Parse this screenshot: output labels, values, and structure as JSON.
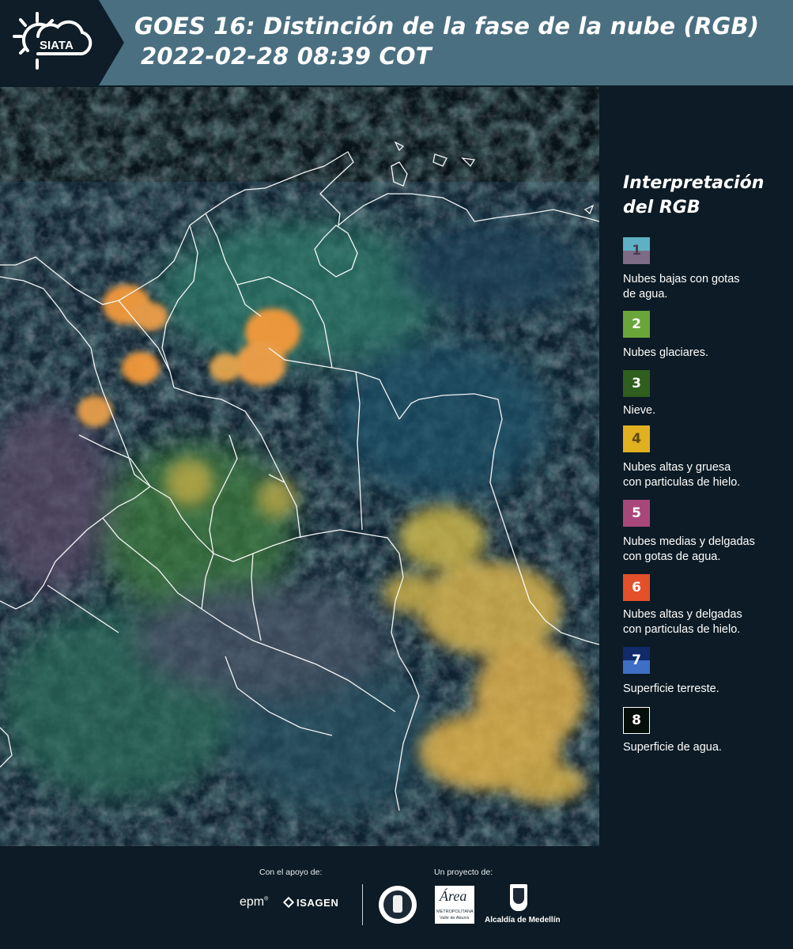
{
  "header": {
    "logo_text": "SIATA",
    "title_line1": "GOES 16: Distinción de la fase de la nube (RGB)",
    "title_line2": "2022-02-28 08:39 COT"
  },
  "legend": {
    "title_line1": "Interpretación",
    "title_line2": "del RGB",
    "items": [
      {
        "number": "1",
        "label_line1": "Nubes bajas con gotas",
        "label_line2": "de agua.",
        "color_top": "#5fb0c4",
        "color_bottom": "#7e6b86"
      },
      {
        "number": "2",
        "label_line1": "Nubes glaciares.",
        "label_line2": "",
        "color_top": "#6aa53a",
        "color_bottom": "#6aa53a"
      },
      {
        "number": "3",
        "label_line1": "Nieve.",
        "label_line2": "",
        "color_top": "#2f5e1f",
        "color_bottom": "#2f5e1f"
      },
      {
        "number": "4",
        "label_line1": "Nubes altas y gruesa",
        "label_line2": "con particulas de hielo.",
        "color_top": "#e0b020",
        "color_bottom": "#e0b020"
      },
      {
        "number": "5",
        "label_line1": "Nubes medias y delgadas",
        "label_line2": "con gotas de agua.",
        "color_top": "#a8487a",
        "color_bottom": "#a8487a"
      },
      {
        "number": "6",
        "label_line1": "Nubes altas y delgadas",
        "label_line2": "con particulas de hielo.",
        "color_top": "#e4502a",
        "color_bottom": "#e4502a"
      },
      {
        "number": "7",
        "label_line1": "Superficie terreste.",
        "label_line2": "",
        "color_top": "#102a6a",
        "color_bottom": "#3d6fc4"
      },
      {
        "number": "8",
        "label_line1": "Superficie de agua.",
        "label_line2": "",
        "color_top": "#050f0a",
        "color_bottom": "#050f0a"
      }
    ]
  },
  "footer": {
    "support_label": "Con el apoyo de:",
    "project_label": "Un proyecto de:",
    "sponsor_epm": "epm",
    "sponsor_isagen": "ISAGEN",
    "area_logo_text": "Área",
    "area_logo_sub1": "METROPOLITANA",
    "area_logo_sub2": "Valle de Aburrá",
    "alcaldia_label": "Alcaldía de Medellín"
  },
  "colors": {
    "header_bg": "#4a6f80",
    "panel_bg": "#0c1b25",
    "cloud_orange": "#f39a3c",
    "cloud_yellow": "#e9b64a"
  }
}
